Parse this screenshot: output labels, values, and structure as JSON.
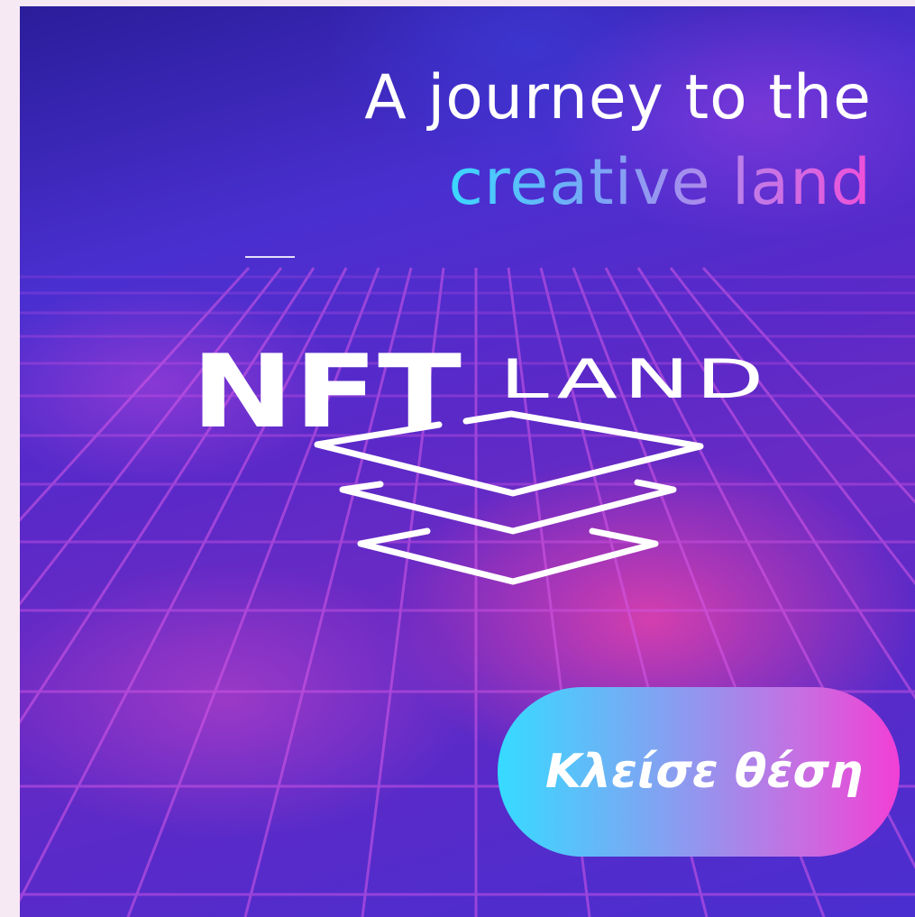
{
  "headline": {
    "line1": "A journey to the",
    "line2": "creative land"
  },
  "logo": {
    "word1": "NFT",
    "word2": "LAND"
  },
  "cta": {
    "label": "Κλείσε θέση"
  },
  "colors": {
    "background_top": "#2a1d9a",
    "background_mid": "#5a29c8",
    "accent_pink": "#e842aa",
    "gradient_start": "#36dbff",
    "gradient_end": "#f23fd5",
    "grid_line": "#d65ae8",
    "text_white": "#ffffff"
  }
}
